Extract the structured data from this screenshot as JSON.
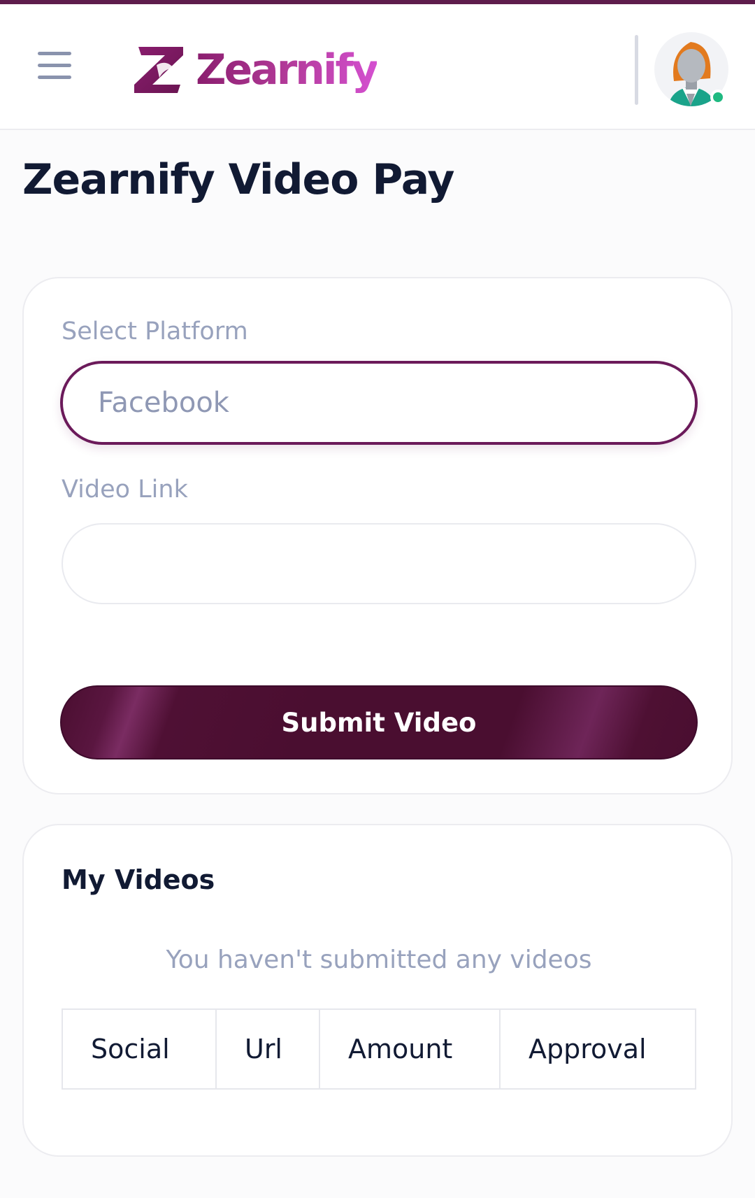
{
  "header": {
    "menu_icon": "hamburger-menu-icon",
    "logo_text": "Zearnify",
    "avatar_icon": "user-avatar-icon",
    "online_status_color": "#1fb981"
  },
  "page": {
    "title": "Zearnify Video Pay"
  },
  "form": {
    "platform_label": "Select Platform",
    "platform_value": "Facebook",
    "video_link_label": "Video Link",
    "video_link_value": "",
    "submit_label": "Submit Video"
  },
  "my_videos": {
    "title": "My Videos",
    "empty_message": "You haven't submitted any videos",
    "columns": [
      "Social",
      "Url",
      "Amount",
      "Approval"
    ]
  },
  "colors": {
    "brand": "#6b1a5a",
    "button": "#4a0e30",
    "title_text": "#111a33",
    "muted_text": "#98a2bd"
  }
}
